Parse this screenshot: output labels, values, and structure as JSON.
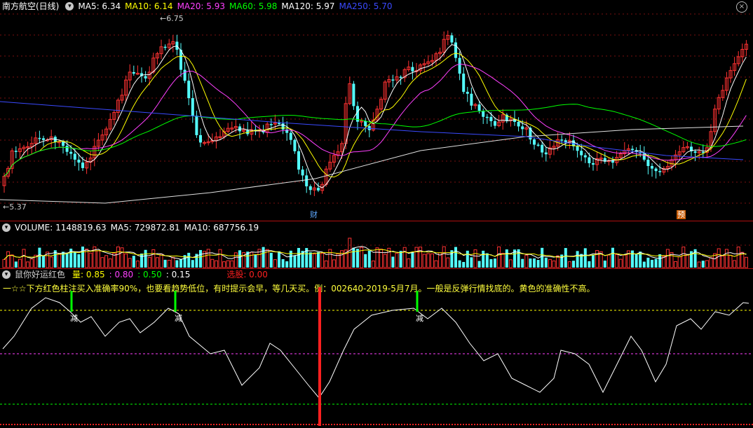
{
  "main": {
    "title": "南方航空(日线)",
    "indicators": [
      {
        "label": "MA5: 6.34",
        "color": "#ffffff"
      },
      {
        "label": "MA10: 6.14",
        "color": "#ffff00"
      },
      {
        "label": "MA20: 5.93",
        "color": "#ff40ff"
      },
      {
        "label": "MA60: 5.98",
        "color": "#00ff00"
      },
      {
        "label": "MA120: 5.97",
        "color": "#ffffff"
      },
      {
        "label": "MA250: 5.70",
        "color": "#3a4aff"
      }
    ],
    "high_marker": "6.75",
    "low_marker": "5.37",
    "event_tags": [
      {
        "label": "财",
        "color": "#5ea8ff",
        "bg": "#000000"
      },
      {
        "label": "预",
        "color": "#ffffff",
        "bg": "#c85a00"
      }
    ],
    "close_icon": "×"
  },
  "volume": {
    "indicators": [
      {
        "label": "VOLUME: 1148819.63",
        "color": "#ffffff"
      },
      {
        "label": "MA5: 729872.81",
        "color": "#ffffff"
      },
      {
        "label": "MA10: 687756.19",
        "color": "#ffffff"
      }
    ]
  },
  "indicator_panel": {
    "name": "鼠你好运红色",
    "params": [
      {
        "label": "量: 0.85",
        "color": "#ffff00"
      },
      {
        "label": ": 0.80",
        "color": "#ff40ff"
      },
      {
        "label": ": 0.50",
        "color": "#00ff00"
      },
      {
        "label": ": 0.15",
        "color": "#ffffff"
      }
    ],
    "select_label": "选股: 0.00",
    "select_color": "#ff2020",
    "annotation": "一☆☆下方红色柱注买入准确率90%，也要看趋势低位，有时提示会早，等几天买。例：002640-2019-5月7月。一般是反弹行情找底的。黄色的准确性不高。",
    "signal_labels": [
      "减",
      "减",
      "减"
    ]
  },
  "colors": {
    "up": "#ff3232",
    "down": "#54ffff",
    "divider": "#b01010"
  }
}
